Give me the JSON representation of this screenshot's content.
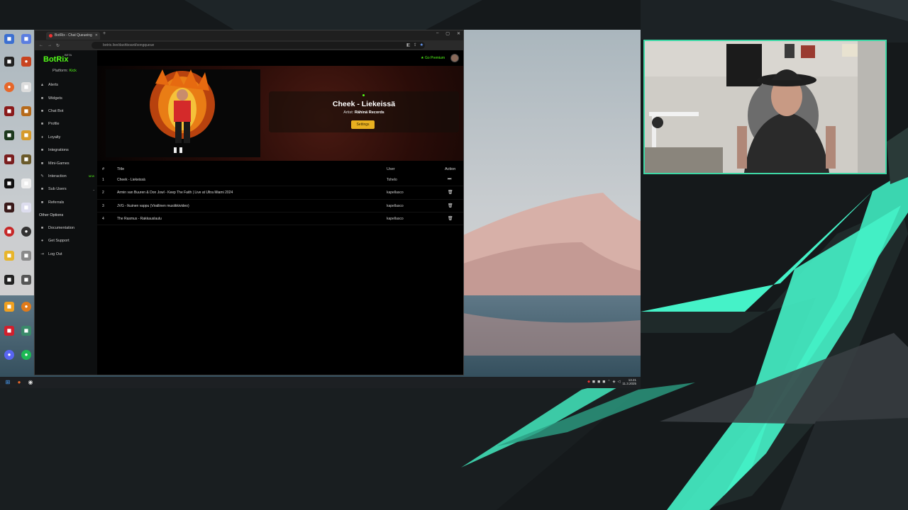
{
  "colors": {
    "kick_green": "#53fc18",
    "overlay_teal": "#45f2c8",
    "overlay_dark": "#14181a",
    "settings_button": "#e8b020"
  },
  "browser": {
    "tab_title": "BotRix - Chat Queueing",
    "url": "botrix.live/dashboard/songqueue"
  },
  "app": {
    "brand": "BotRix",
    "brand_tag": "BETA",
    "platform_label": "Platform:",
    "platform_value": "Kick",
    "go_premium": "Go Premium",
    "menu": [
      {
        "label": "Alerts",
        "icon": "bell-icon",
        "glyph": "▲"
      },
      {
        "label": "Widgets",
        "icon": "widgets-icon",
        "glyph": "■"
      },
      {
        "label": "Chat Bot",
        "icon": "chat-icon",
        "glyph": "■"
      },
      {
        "label": "Profile",
        "icon": "profile-icon",
        "glyph": "■"
      },
      {
        "label": "Loyalty",
        "icon": "loyalty-icon",
        "glyph": "♦"
      },
      {
        "label": "Integrations",
        "icon": "integrations-icon",
        "glyph": "■"
      },
      {
        "label": "Mini-Games",
        "icon": "games-icon",
        "glyph": "■"
      },
      {
        "label": "Interaction",
        "icon": "interaction-icon",
        "glyph": "✎",
        "badge": "NEW"
      },
      {
        "label": "Sub Users",
        "icon": "users-icon",
        "glyph": "■",
        "chevron": "⌄"
      },
      {
        "label": "Referrals",
        "icon": "referrals-icon",
        "glyph": "■"
      }
    ],
    "other_options_heading": "Other Options",
    "other_menu": [
      {
        "label": "Documentation",
        "icon": "docs-icon",
        "glyph": "■"
      },
      {
        "label": "Get Support",
        "icon": "support-icon",
        "glyph": "●"
      },
      {
        "label": "Log Out",
        "icon": "logout-icon",
        "glyph": "⇥"
      }
    ],
    "now_playing": {
      "title": "Cheek - Liekeissä",
      "artist_label": "Artist:",
      "artist": "Rähinä Records",
      "settings_button": "Settings"
    },
    "queue": {
      "headers": {
        "num": "#",
        "title": "Title",
        "user": "User",
        "action": "Action"
      },
      "rows": [
        {
          "num": "1",
          "title": "Cheek - Liekeissä",
          "user": "Tohelo",
          "action_icon": "skip-icon",
          "action_glyph": "⏭"
        },
        {
          "num": "2",
          "title": "Armin van Buuren & Don Jowl - Keep The Faith | Live at Ultra Miami 2024",
          "user": "kapellasco",
          "action_icon": "delete-icon",
          "action_glyph": "🗑"
        },
        {
          "num": "3",
          "title": "JVG - Ikuinen vappu (Virallinen musiikkivideo)",
          "user": "kapellasco",
          "action_icon": "delete-icon",
          "action_glyph": "🗑"
        },
        {
          "num": "4",
          "title": "The Rasmus - Rakkauslaulu",
          "user": "kapellasco",
          "action_icon": "delete-icon",
          "action_glyph": "🗑"
        }
      ]
    }
  },
  "taskbar": {
    "time": "13.21",
    "date": "11.3.2025"
  }
}
